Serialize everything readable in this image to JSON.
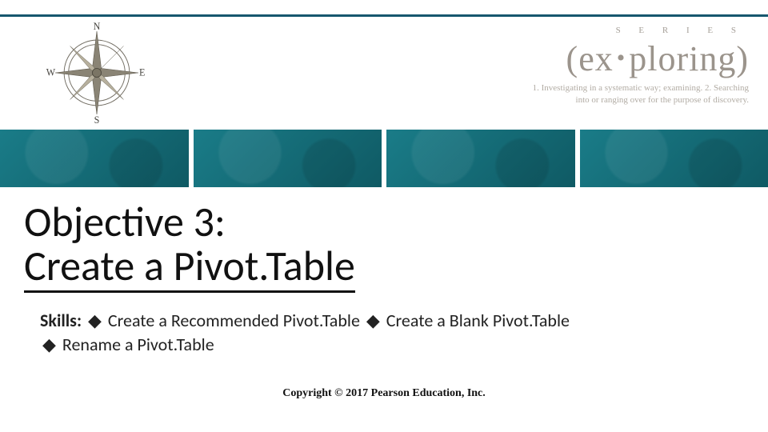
{
  "header": {
    "compass": {
      "n": "N",
      "e": "E",
      "s": "S",
      "w": "W"
    },
    "brand": {
      "series": "S E R I E S",
      "wordmark_open": "(",
      "wordmark_left": "ex",
      "wordmark_dot": "•",
      "wordmark_right": "ploring",
      "wordmark_close": ")",
      "def1": "1. Investigating in a systematic way; examining. 2. Searching",
      "def2": "into or ranging over for the purpose of discovery."
    }
  },
  "title": {
    "line1": "Objective 3:",
    "line2": "Create a Pivot.Table"
  },
  "skills": {
    "label": "Skills:",
    "bullet": "◆",
    "items": [
      "Create a Recommended Pivot.Table",
      "Create a Blank Pivot.Table",
      "Rename a Pivot.Table"
    ]
  },
  "footer": "Copyright © 2017 Pearson Education, Inc."
}
